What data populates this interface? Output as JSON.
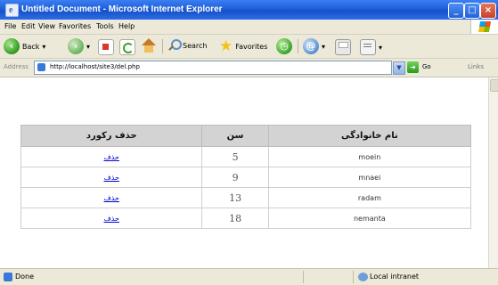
{
  "window": {
    "title": "Untitled Document - Microsoft Internet Explorer",
    "minimize": "_",
    "maximize": "□",
    "close": "×"
  },
  "menu": [
    "File",
    "Edit",
    "View",
    "Favorites",
    "Tools",
    "Help"
  ],
  "toolbar": {
    "back": "Back",
    "search": "Search",
    "favorites": "Favorites"
  },
  "address": {
    "label": "Address",
    "url": "http://localhost/site3/del.php",
    "go": "Go",
    "links": "Links"
  },
  "table": {
    "headers": [
      "نام خانوادگی",
      "سن",
      "حذف رکورد"
    ],
    "rows": [
      {
        "name": "moein",
        "age": "5",
        "action": "حذف"
      },
      {
        "name": "mnaei",
        "age": "9",
        "action": "حذف"
      },
      {
        "name": "radam",
        "age": "13",
        "action": "حذف"
      },
      {
        "name": "nemanta",
        "age": "18",
        "action": "حذف"
      }
    ]
  },
  "status": {
    "text": "Done",
    "zone": "Local intranet"
  },
  "colors": {
    "titlebar": "#1d5fd8",
    "header_bg": "#d3d3d3",
    "link": "#0000d0"
  }
}
